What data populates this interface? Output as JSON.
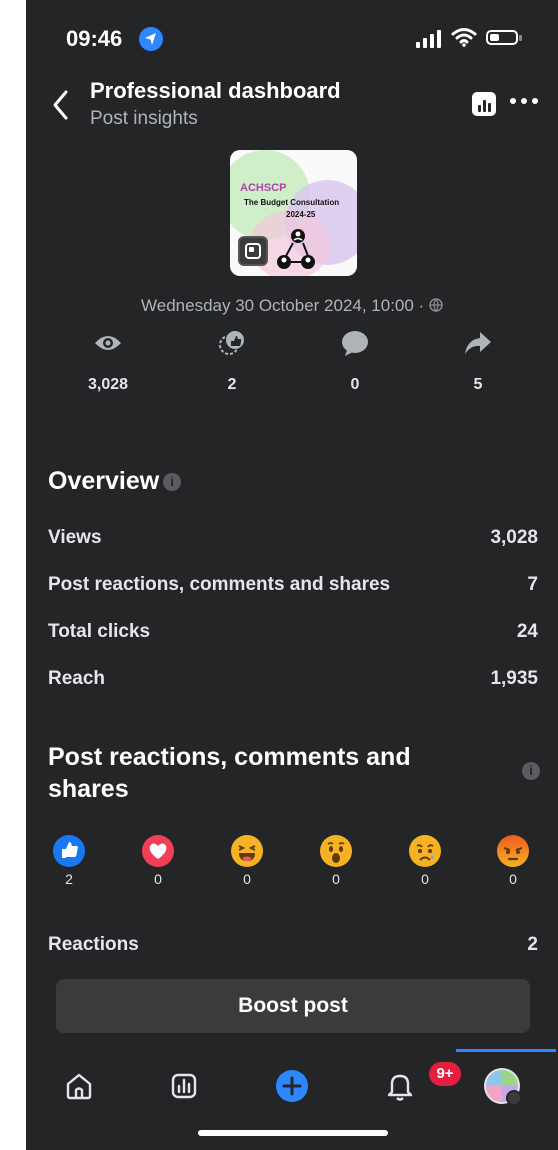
{
  "status_bar": {
    "time": "09:46"
  },
  "header": {
    "title": "Professional dashboard",
    "subtitle": "Post insights"
  },
  "post": {
    "image_text_1": "ACHSCP",
    "image_text_2": "The Budget Consultation",
    "image_text_3": "2024-25",
    "date": "Wednesday 30 October 2024, 10:00 ·"
  },
  "stats": [
    {
      "icon": "eye-icon",
      "value": "3,028"
    },
    {
      "icon": "reactions-icon",
      "value": "2"
    },
    {
      "icon": "comment-icon",
      "value": "0"
    },
    {
      "icon": "share-icon",
      "value": "5"
    }
  ],
  "overview": {
    "title": "Overview",
    "info_icon": "i",
    "rows": [
      {
        "label": "Views",
        "value": "3,028"
      },
      {
        "label": "Post reactions, comments and shares",
        "value": "7"
      },
      {
        "label": "Total clicks",
        "value": "24"
      },
      {
        "label": "Reach",
        "value": "1,935"
      }
    ]
  },
  "engagement": {
    "title_line1": "Post reactions, comments and",
    "title_line2": "shares",
    "info_icon": "i",
    "reactions": [
      {
        "type": "like",
        "count": "2"
      },
      {
        "type": "love",
        "count": "0"
      },
      {
        "type": "haha",
        "count": "0"
      },
      {
        "type": "wow",
        "count": "0"
      },
      {
        "type": "sad",
        "count": "0"
      },
      {
        "type": "angry",
        "count": "0"
      }
    ],
    "reactions_label": "Reactions",
    "reactions_total": "2"
  },
  "boost_label": "Boost post",
  "tabbar": {
    "notification_badge": "9+"
  },
  "colors": {
    "background": "#242526",
    "accent": "#2d88ff",
    "badge": "#e41e3f",
    "button": "#3a3b3c"
  }
}
